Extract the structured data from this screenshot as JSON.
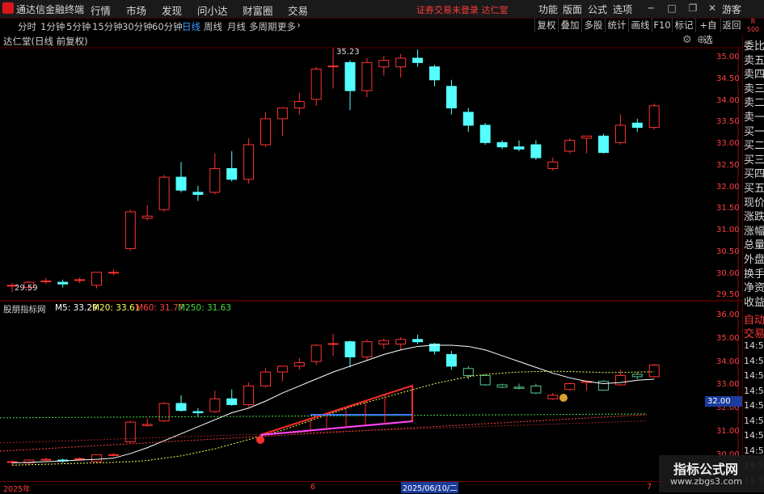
{
  "app": {
    "title": "通达信金融终端"
  },
  "menu": [
    "行情",
    "市场",
    "发现",
    "问小达",
    "财富圈",
    "交易"
  ],
  "warning": "证券交易未登录  达仁堂",
  "right_menu": [
    "功能",
    "版面",
    "公式",
    "选项"
  ],
  "guest": "游客",
  "r_badge": {
    "letter": "R",
    "num": "500"
  },
  "periods": [
    "分时",
    "1分钟",
    "5分钟",
    "15分钟",
    "30分钟",
    "60分钟",
    "日线",
    "周线",
    "月线",
    "多周期",
    "更多"
  ],
  "active_period": "日线",
  "toolbar": [
    "复权",
    "叠加",
    "多股",
    "统计",
    "画线",
    "F10",
    "标记",
    "+自选",
    "返回"
  ],
  "stock_label": "达仁堂(日线 前复权)",
  "price_marks": {
    "high": "35.23",
    "low": "29.59"
  },
  "upper_axis": [
    "35.00",
    "34.50",
    "34.00",
    "33.50",
    "33.00",
    "32.50",
    "32.00",
    "31.50",
    "31.00",
    "30.50",
    "30.00",
    "29.50"
  ],
  "lower_axis": [
    "36.00",
    "35.00",
    "34.00",
    "33.00",
    "32.00",
    "31.00",
    "30.00"
  ],
  "ma_legend": {
    "name": "股朋指标网",
    "items": [
      {
        "label": "M5: 33.29",
        "color": "#ffffff"
      },
      {
        "label": "M20: 33.61",
        "color": "#ffff55"
      },
      {
        "label": "M60: 31.77",
        "color": "#ff4040"
      },
      {
        "label": "M250: 31.63",
        "color": "#44dd44"
      }
    ]
  },
  "right_panel": [
    "委比",
    "卖五",
    "卖四",
    "卖三",
    "卖二",
    "卖一",
    "买一",
    "买二",
    "买三",
    "买四",
    "买五",
    "现价",
    "涨跌",
    "涨幅",
    "总量",
    "外盘",
    "换手",
    "净资",
    "收益"
  ],
  "right_panel_auto": [
    "自动",
    "交易"
  ],
  "right_times": [
    "14:56",
    "14:56",
    "14:56",
    "14:56",
    "14:56",
    "14:56",
    "14:56",
    "14:56",
    "14:56",
    "14:56"
  ],
  "cursor_price": "32.00",
  "dates": {
    "start": "2025年",
    "mid": "6",
    "selected": "2025/06/10/二",
    "end": "7"
  },
  "watermark": {
    "line1": "指标公式网",
    "line2": "www.zbgs3.com"
  },
  "colors": {
    "up": "#ff3232",
    "down": "#54ffff",
    "axis": "#7a0000"
  },
  "chart_data": {
    "type": "candlestick",
    "ylim": [
      29.4,
      35.3
    ],
    "candles": [
      {
        "o": 29.75,
        "h": 29.8,
        "l": 29.59,
        "c": 29.75
      },
      {
        "o": 29.7,
        "h": 29.85,
        "l": 29.62,
        "c": 29.82
      },
      {
        "o": 29.85,
        "h": 29.92,
        "l": 29.78,
        "c": 29.85
      },
      {
        "o": 29.82,
        "h": 29.88,
        "l": 29.7,
        "c": 29.78
      },
      {
        "o": 29.88,
        "h": 29.93,
        "l": 29.8,
        "c": 29.88
      },
      {
        "o": 29.75,
        "h": 30.05,
        "l": 29.68,
        "c": 30.05
      },
      {
        "o": 30.05,
        "h": 30.12,
        "l": 29.98,
        "c": 30.05
      },
      {
        "o": 30.6,
        "h": 31.5,
        "l": 30.55,
        "c": 31.45
      },
      {
        "o": 31.3,
        "h": 31.6,
        "l": 31.25,
        "c": 31.35
      },
      {
        "o": 31.5,
        "h": 32.3,
        "l": 31.45,
        "c": 32.25
      },
      {
        "o": 32.25,
        "h": 32.6,
        "l": 31.9,
        "c": 31.95
      },
      {
        "o": 31.9,
        "h": 32.05,
        "l": 31.7,
        "c": 31.85
      },
      {
        "o": 31.9,
        "h": 32.8,
        "l": 31.85,
        "c": 32.45
      },
      {
        "o": 32.45,
        "h": 32.85,
        "l": 32.15,
        "c": 32.2
      },
      {
        "o": 32.2,
        "h": 33.15,
        "l": 32.1,
        "c": 33.0
      },
      {
        "o": 33.0,
        "h": 33.75,
        "l": 32.95,
        "c": 33.6
      },
      {
        "o": 33.6,
        "h": 33.8,
        "l": 33.2,
        "c": 33.85
      },
      {
        "o": 33.85,
        "h": 34.2,
        "l": 33.7,
        "c": 34.0
      },
      {
        "o": 34.05,
        "h": 34.8,
        "l": 33.9,
        "c": 34.75
      },
      {
        "o": 34.82,
        "h": 35.23,
        "l": 34.3,
        "c": 34.82
      },
      {
        "o": 34.9,
        "h": 34.95,
        "l": 33.8,
        "c": 34.25
      },
      {
        "o": 34.25,
        "h": 35.0,
        "l": 34.1,
        "c": 34.9
      },
      {
        "o": 34.8,
        "h": 35.05,
        "l": 34.6,
        "c": 34.95
      },
      {
        "o": 34.8,
        "h": 35.1,
        "l": 34.55,
        "c": 35.0
      },
      {
        "o": 35.0,
        "h": 35.2,
        "l": 34.8,
        "c": 34.9
      },
      {
        "o": 34.8,
        "h": 34.85,
        "l": 34.35,
        "c": 34.5
      },
      {
        "o": 34.35,
        "h": 34.5,
        "l": 33.7,
        "c": 33.85
      },
      {
        "o": 33.75,
        "h": 33.85,
        "l": 33.3,
        "c": 33.45
      },
      {
        "o": 33.45,
        "h": 33.5,
        "l": 33.0,
        "c": 33.05
      },
      {
        "o": 33.05,
        "h": 33.1,
        "l": 32.9,
        "c": 32.95
      },
      {
        "o": 32.95,
        "h": 33.1,
        "l": 32.85,
        "c": 32.9
      },
      {
        "o": 33.0,
        "h": 33.1,
        "l": 32.65,
        "c": 32.7
      },
      {
        "o": 32.45,
        "h": 32.7,
        "l": 32.4,
        "c": 32.6
      },
      {
        "o": 32.85,
        "h": 33.15,
        "l": 32.8,
        "c": 33.1
      },
      {
        "o": 33.15,
        "h": 33.2,
        "l": 32.8,
        "c": 33.2
      },
      {
        "o": 33.2,
        "h": 33.25,
        "l": 32.8,
        "c": 32.82
      },
      {
        "o": 33.05,
        "h": 33.7,
        "l": 33.0,
        "c": 33.45
      },
      {
        "o": 33.5,
        "h": 33.6,
        "l": 33.3,
        "c": 33.4
      },
      {
        "o": 33.4,
        "h": 33.95,
        "l": 33.35,
        "c": 33.9
      }
    ],
    "ma5": [
      29.7,
      29.72,
      29.75,
      29.78,
      29.82,
      29.85,
      29.9,
      30.1,
      30.35,
      30.65,
      30.95,
      31.25,
      31.55,
      31.85,
      32.05,
      32.35,
      32.7,
      33.0,
      33.3,
      33.6,
      33.85,
      34.1,
      34.35,
      34.55,
      34.7,
      34.75,
      34.75,
      34.7,
      34.55,
      34.3,
      34.05,
      33.8,
      33.55,
      33.35,
      33.2,
      33.1,
      33.15,
      33.25,
      33.29
    ],
    "ma20": [
      29.6,
      29.62,
      29.64,
      29.66,
      29.68,
      29.7,
      29.72,
      29.75,
      29.8,
      29.9,
      30.0,
      30.15,
      30.3,
      30.5,
      30.7,
      30.9,
      31.1,
      31.35,
      31.6,
      31.85,
      32.1,
      32.3,
      32.5,
      32.7,
      32.9,
      33.1,
      33.25,
      33.4,
      33.5,
      33.55,
      33.6,
      33.62,
      33.63,
      33.62,
      33.6,
      33.58,
      33.58,
      33.6,
      33.61
    ]
  }
}
